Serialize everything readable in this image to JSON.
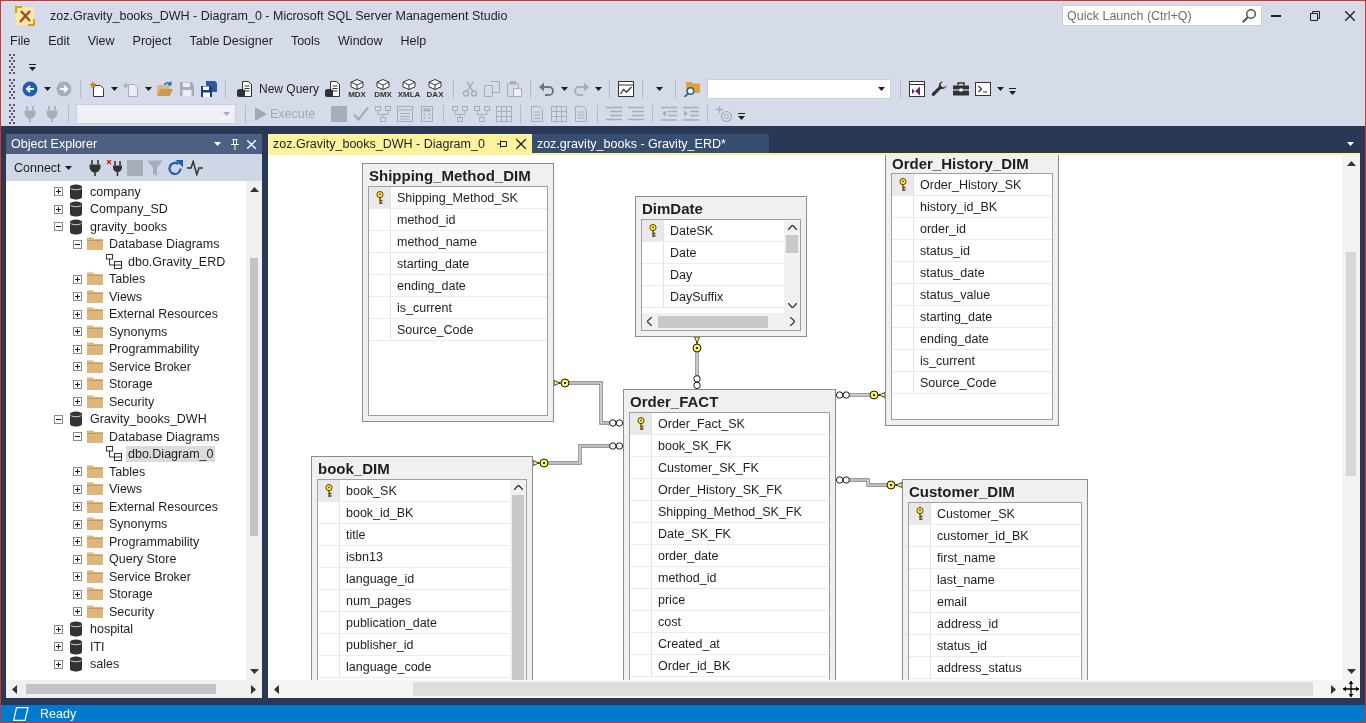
{
  "window": {
    "title": "zoz.Gravity_books_DWH - Diagram_0 - Microsoft SQL Server Management Studio"
  },
  "quick_launch": {
    "placeholder": "Quick Launch (Ctrl+Q)"
  },
  "menu": [
    "File",
    "Edit",
    "View",
    "Project",
    "Table Designer",
    "Tools",
    "Window",
    "Help"
  ],
  "standard_toolbar": {
    "new_query": "New Query",
    "query_types": [
      "MDX",
      "DMX",
      "XMLA",
      "DAX"
    ]
  },
  "query_toolbar": {
    "execute": "Execute",
    "disabled": true
  },
  "object_explorer": {
    "title": "Object Explorer",
    "connect": "Connect",
    "tree": [
      {
        "label": "company",
        "kind": "database",
        "expanded": false,
        "selected": false
      },
      {
        "label": "Company_SD",
        "kind": "database",
        "expanded": false,
        "selected": false
      },
      {
        "label": "gravity_books",
        "kind": "database",
        "expanded": true,
        "selected": false,
        "children": [
          {
            "label": "Database Diagrams",
            "kind": "folder",
            "expanded": true,
            "selected": false,
            "children": [
              {
                "label": "dbo.Gravity_ERD",
                "kind": "diagram",
                "selected": false
              }
            ]
          },
          {
            "label": "Tables",
            "kind": "folder",
            "expanded": false,
            "selected": false
          },
          {
            "label": "Views",
            "kind": "folder",
            "expanded": false,
            "selected": false
          },
          {
            "label": "External Resources",
            "kind": "folder",
            "expanded": false,
            "selected": false
          },
          {
            "label": "Synonyms",
            "kind": "folder",
            "expanded": false,
            "selected": false
          },
          {
            "label": "Programmability",
            "kind": "folder",
            "expanded": false,
            "selected": false
          },
          {
            "label": "Service Broker",
            "kind": "folder",
            "expanded": false,
            "selected": false
          },
          {
            "label": "Storage",
            "kind": "folder",
            "expanded": false,
            "selected": false
          },
          {
            "label": "Security",
            "kind": "folder",
            "expanded": false,
            "selected": false
          }
        ]
      },
      {
        "label": "Gravity_books_DWH",
        "kind": "database",
        "expanded": true,
        "selected": false,
        "children": [
          {
            "label": "Database Diagrams",
            "kind": "folder",
            "expanded": true,
            "selected": false,
            "children": [
              {
                "label": "dbo.Diagram_0",
                "kind": "diagram",
                "selected": true
              }
            ]
          },
          {
            "label": "Tables",
            "kind": "folder",
            "expanded": false,
            "selected": false
          },
          {
            "label": "Views",
            "kind": "folder",
            "expanded": false,
            "selected": false
          },
          {
            "label": "External Resources",
            "kind": "folder",
            "expanded": false,
            "selected": false
          },
          {
            "label": "Synonyms",
            "kind": "folder",
            "expanded": false,
            "selected": false
          },
          {
            "label": "Programmability",
            "kind": "folder",
            "expanded": false,
            "selected": false
          },
          {
            "label": "Query Store",
            "kind": "folder",
            "expanded": false,
            "selected": false
          },
          {
            "label": "Service Broker",
            "kind": "folder",
            "expanded": false,
            "selected": false
          },
          {
            "label": "Storage",
            "kind": "folder",
            "expanded": false,
            "selected": false
          },
          {
            "label": "Security",
            "kind": "folder",
            "expanded": false,
            "selected": false
          }
        ]
      },
      {
        "label": "hospital",
        "kind": "database",
        "expanded": false,
        "selected": false
      },
      {
        "label": "ITI",
        "kind": "database",
        "expanded": false,
        "selected": false
      },
      {
        "label": "sales",
        "kind": "database",
        "expanded": false,
        "selected": false
      }
    ]
  },
  "tabs": [
    {
      "label": "zoz.Gravity_books_DWH - Diagram_0",
      "selected": true
    },
    {
      "label": "zoz.gravity_books - Gravity_ERD*",
      "selected": false
    }
  ],
  "diagram": {
    "tables": [
      {
        "name": "Shipping_Method_DIM",
        "vertical_scrollbar": false,
        "horizontal_scrollbar": false,
        "columns": [
          {
            "name": "Shipping_Method_SK",
            "primary_key": true
          },
          {
            "name": "method_id",
            "primary_key": false
          },
          {
            "name": "method_name",
            "primary_key": false
          },
          {
            "name": "starting_date",
            "primary_key": false
          },
          {
            "name": "ending_date",
            "primary_key": false
          },
          {
            "name": "is_current",
            "primary_key": false
          },
          {
            "name": "Source_Code",
            "primary_key": false
          }
        ]
      },
      {
        "name": "DimDate",
        "vertical_scrollbar": true,
        "horizontal_scrollbar": true,
        "columns": [
          {
            "name": "DateSK",
            "primary_key": true
          },
          {
            "name": "Date",
            "primary_key": false
          },
          {
            "name": "Day",
            "primary_key": false
          },
          {
            "name": "DaySuffix",
            "primary_key": false
          }
        ]
      },
      {
        "name": "Order_History_DIM",
        "vertical_scrollbar": false,
        "horizontal_scrollbar": false,
        "columns": [
          {
            "name": "Order_History_SK",
            "primary_key": true
          },
          {
            "name": "history_id_BK",
            "primary_key": false
          },
          {
            "name": "order_id",
            "primary_key": false
          },
          {
            "name": "status_id",
            "primary_key": false
          },
          {
            "name": "status_date",
            "primary_key": false
          },
          {
            "name": "status_value",
            "primary_key": false
          },
          {
            "name": "starting_date",
            "primary_key": false
          },
          {
            "name": "ending_date",
            "primary_key": false
          },
          {
            "name": "is_current",
            "primary_key": false
          },
          {
            "name": "Source_Code",
            "primary_key": false
          }
        ]
      },
      {
        "name": "book_DIM",
        "vertical_scrollbar": true,
        "horizontal_scrollbar": false,
        "columns": [
          {
            "name": "book_SK",
            "primary_key": true
          },
          {
            "name": "book_id_BK",
            "primary_key": false
          },
          {
            "name": "title",
            "primary_key": false
          },
          {
            "name": "isbn13",
            "primary_key": false
          },
          {
            "name": "language_id",
            "primary_key": false
          },
          {
            "name": "num_pages",
            "primary_key": false
          },
          {
            "name": "publication_date",
            "primary_key": false
          },
          {
            "name": "publisher_id",
            "primary_key": false
          },
          {
            "name": "language_code",
            "primary_key": false
          }
        ]
      },
      {
        "name": "Order_FACT",
        "vertical_scrollbar": false,
        "horizontal_scrollbar": false,
        "columns": [
          {
            "name": "Order_Fact_SK",
            "primary_key": true
          },
          {
            "name": "book_SK_FK",
            "primary_key": false
          },
          {
            "name": "Customer_SK_FK",
            "primary_key": false
          },
          {
            "name": "Order_History_SK_FK",
            "primary_key": false
          },
          {
            "name": "Shipping_Method_SK_FK",
            "primary_key": false
          },
          {
            "name": "Date_SK_FK",
            "primary_key": false
          },
          {
            "name": "order_date",
            "primary_key": false
          },
          {
            "name": "method_id",
            "primary_key": false
          },
          {
            "name": "price",
            "primary_key": false
          },
          {
            "name": "cost",
            "primary_key": false
          },
          {
            "name": "Created_at",
            "primary_key": false
          },
          {
            "name": "Order_id_BK",
            "primary_key": false
          }
        ]
      },
      {
        "name": "Customer_DIM",
        "vertical_scrollbar": false,
        "horizontal_scrollbar": false,
        "columns": [
          {
            "name": "Customer_SK",
            "primary_key": true
          },
          {
            "name": "customer_id_BK",
            "primary_key": false
          },
          {
            "name": "first_name",
            "primary_key": false
          },
          {
            "name": "last_name",
            "primary_key": false
          },
          {
            "name": "email",
            "primary_key": false
          },
          {
            "name": "address_id",
            "primary_key": false
          },
          {
            "name": "status_id",
            "primary_key": false
          },
          {
            "name": "address_status",
            "primary_key": false
          }
        ]
      }
    ]
  },
  "status_bar": {
    "text": "Ready"
  }
}
